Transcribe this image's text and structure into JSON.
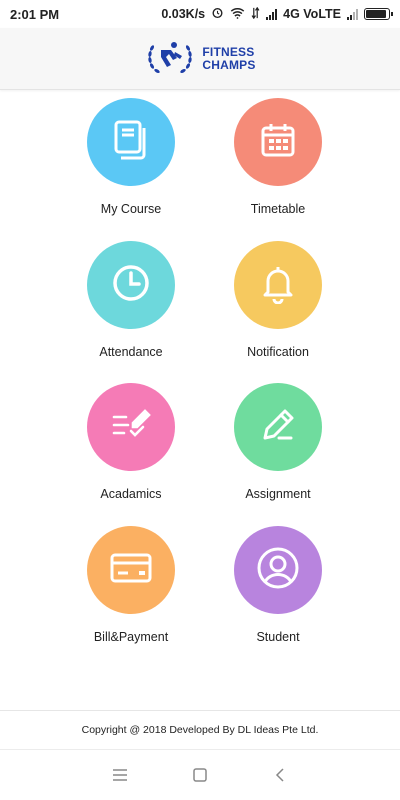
{
  "status_bar": {
    "time": "2:01 PM",
    "speed": "0.03K/s",
    "network": "4G VoLTE"
  },
  "header": {
    "logo_line1": "FITNESS",
    "logo_line2": "CHAMPS"
  },
  "colors": {
    "brand": "#1f3fa8",
    "my_course": "#5bc8f5",
    "timetable": "#f58b78",
    "attendance": "#6dd8dc",
    "notification": "#f6c95f",
    "academics": "#f57bb6",
    "assignment": "#6fdc9e",
    "bill_payment": "#fbb062",
    "student": "#b884de"
  },
  "menu": {
    "my_course": "My Course",
    "timetable": "Timetable",
    "attendance": "Attendance",
    "notification": "Notification",
    "academics": "Acadamics",
    "assignment": "Assignment",
    "bill_payment": "Bill&Payment",
    "student": "Student"
  },
  "footer": {
    "copyright": "Copyright @ 2018 Developed By DL Ideas Pte Ltd."
  },
  "nav": {
    "icons": [
      "menu-icon",
      "home-square-icon",
      "back-chevron-icon"
    ]
  }
}
